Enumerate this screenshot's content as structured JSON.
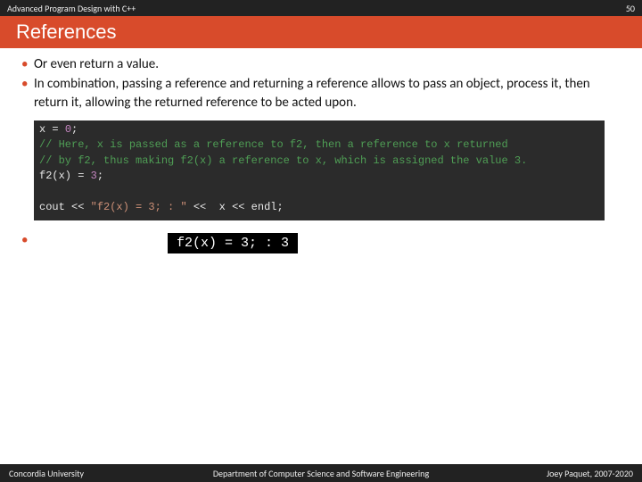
{
  "topbar": {
    "left": "Advanced Program Design with C++",
    "right": "50"
  },
  "title": "References",
  "bullets": [
    "Or even return a value.",
    "In combination, passing a reference and returning a reference allows to pass an object, process it, then return it, allowing the returned reference to be acted upon."
  ],
  "code": {
    "l1_a": "x ",
    "l1_eq": "=",
    "l1_b": " ",
    "l1_num": "0",
    "l1_end": ";",
    "l2": "// Here, x is passed as a reference to f2, then a reference to x returned",
    "l3": "// by f2, thus making f2(x) a reference to x, which is assigned the value 3.",
    "l4_a": "f2",
    "l4_b": "(x) ",
    "l4_eq": "=",
    "l4_c": " ",
    "l4_num": "3",
    "l4_end": ";",
    "l5": " ",
    "l6_a": "cout ",
    "l6_op1": "<<",
    "l6_b": " ",
    "l6_str": "\"f2(x) = 3; : \"",
    "l6_c": " ",
    "l6_op2": "<<",
    "l6_d": "  x ",
    "l6_op3": "<<",
    "l6_e": " endl;"
  },
  "output": "f2(x) = 3; : 3",
  "footer": {
    "left": "Concordia University",
    "mid": "Department of Computer Science and Software Engineering",
    "right": "Joey Paquet, 2007-2020"
  }
}
